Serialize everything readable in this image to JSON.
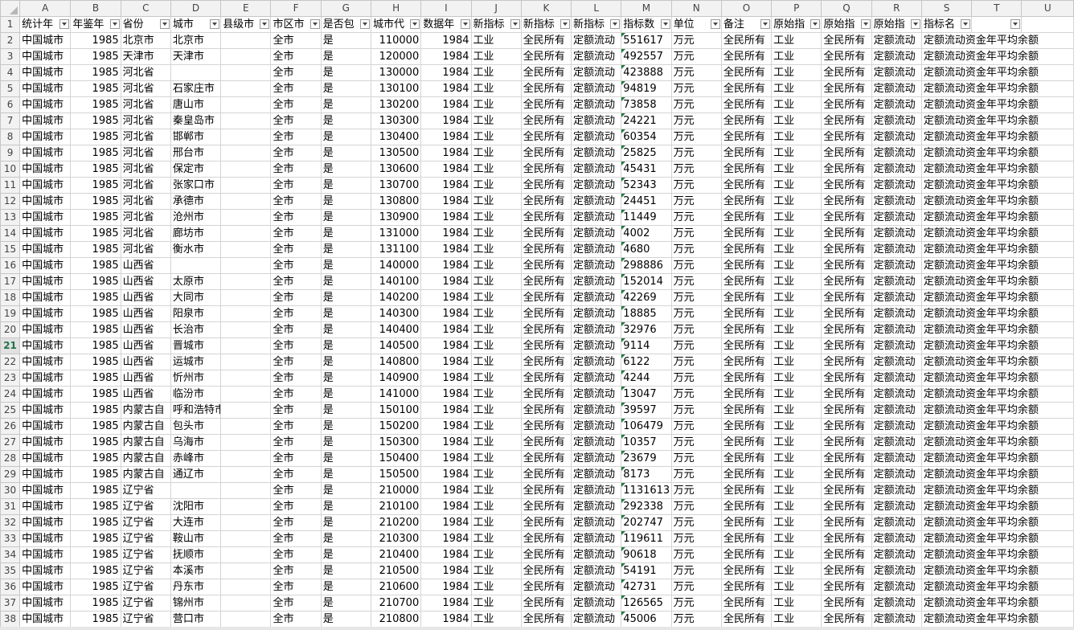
{
  "columns": [
    "A",
    "B",
    "C",
    "D",
    "E",
    "F",
    "G",
    "H",
    "I",
    "J",
    "K",
    "L",
    "M",
    "N",
    "O",
    "P",
    "Q",
    "R",
    "S",
    "T",
    "U"
  ],
  "headers": [
    "统计年",
    "年鉴年",
    "省份",
    "城市",
    "县级市",
    "市区市",
    "是否包",
    "城市代",
    "数据年",
    "新指标",
    "新指标",
    "新指标",
    "指标数",
    "单位",
    "备注",
    "原始指",
    "原始指",
    "原始指",
    "指标名",
    "",
    ""
  ],
  "filter_icon": "filter-dropdown-icon",
  "selected_row": 21,
  "rows": [
    {
      "n": 2,
      "city": "北京市",
      "province": "北京市",
      "code": "110000",
      "value": "551617"
    },
    {
      "n": 3,
      "city": "天津市",
      "province": "天津市",
      "code": "120000",
      "value": "492557"
    },
    {
      "n": 4,
      "city": "",
      "province": "河北省",
      "code": "130000",
      "value": "423888"
    },
    {
      "n": 5,
      "city": "石家庄市",
      "province": "河北省",
      "code": "130100",
      "value": "94819"
    },
    {
      "n": 6,
      "city": "唐山市",
      "province": "河北省",
      "code": "130200",
      "value": "73858"
    },
    {
      "n": 7,
      "city": "秦皇岛市",
      "province": "河北省",
      "code": "130300",
      "value": "24221"
    },
    {
      "n": 8,
      "city": "邯郸市",
      "province": "河北省",
      "code": "130400",
      "value": "60354"
    },
    {
      "n": 9,
      "city": "邢台市",
      "province": "河北省",
      "code": "130500",
      "value": "25825"
    },
    {
      "n": 10,
      "city": "保定市",
      "province": "河北省",
      "code": "130600",
      "value": "45431"
    },
    {
      "n": 11,
      "city": "张家口市",
      "province": "河北省",
      "code": "130700",
      "value": "52343"
    },
    {
      "n": 12,
      "city": "承德市",
      "province": "河北省",
      "code": "130800",
      "value": "24451"
    },
    {
      "n": 13,
      "city": "沧州市",
      "province": "河北省",
      "code": "130900",
      "value": "11449"
    },
    {
      "n": 14,
      "city": "廊坊市",
      "province": "河北省",
      "code": "131000",
      "value": "4002"
    },
    {
      "n": 15,
      "city": "衡水市",
      "province": "河北省",
      "code": "131100",
      "value": "4680"
    },
    {
      "n": 16,
      "city": "",
      "province": "山西省",
      "code": "140000",
      "value": "298886"
    },
    {
      "n": 17,
      "city": "太原市",
      "province": "山西省",
      "code": "140100",
      "value": "152014"
    },
    {
      "n": 18,
      "city": "大同市",
      "province": "山西省",
      "code": "140200",
      "value": "42269"
    },
    {
      "n": 19,
      "city": "阳泉市",
      "province": "山西省",
      "code": "140300",
      "value": "18885"
    },
    {
      "n": 20,
      "city": "长治市",
      "province": "山西省",
      "code": "140400",
      "value": "32976"
    },
    {
      "n": 21,
      "city": "晋城市",
      "province": "山西省",
      "code": "140500",
      "value": "9114"
    },
    {
      "n": 22,
      "city": "运城市",
      "province": "山西省",
      "code": "140800",
      "value": "6122"
    },
    {
      "n": 23,
      "city": "忻州市",
      "province": "山西省",
      "code": "140900",
      "value": "4244"
    },
    {
      "n": 24,
      "city": "临汾市",
      "province": "山西省",
      "code": "141000",
      "value": "13047"
    },
    {
      "n": 25,
      "city": "呼和浩特市",
      "province": "内蒙古自",
      "code": "150100",
      "value": "39597"
    },
    {
      "n": 26,
      "city": "包头市",
      "province": "内蒙古自",
      "code": "150200",
      "value": "106479"
    },
    {
      "n": 27,
      "city": "乌海市",
      "province": "内蒙古自",
      "code": "150300",
      "value": "10357"
    },
    {
      "n": 28,
      "city": "赤峰市",
      "province": "内蒙古自",
      "code": "150400",
      "value": "23679"
    },
    {
      "n": 29,
      "city": "通辽市",
      "province": "内蒙古自",
      "code": "150500",
      "value": "8173"
    },
    {
      "n": 30,
      "city": "",
      "province": "辽宁省",
      "code": "210000",
      "value": "1131613"
    },
    {
      "n": 31,
      "city": "沈阳市",
      "province": "辽宁省",
      "code": "210100",
      "value": "292338"
    },
    {
      "n": 32,
      "city": "大连市",
      "province": "辽宁省",
      "code": "210200",
      "value": "202747"
    },
    {
      "n": 33,
      "city": "鞍山市",
      "province": "辽宁省",
      "code": "210300",
      "value": "119611"
    },
    {
      "n": 34,
      "city": "抚顺市",
      "province": "辽宁省",
      "code": "210400",
      "value": "90618"
    },
    {
      "n": 35,
      "city": "本溪市",
      "province": "辽宁省",
      "code": "210500",
      "value": "54191"
    },
    {
      "n": 36,
      "city": "丹东市",
      "province": "辽宁省",
      "code": "210600",
      "value": "42731"
    },
    {
      "n": 37,
      "city": "锦州市",
      "province": "辽宁省",
      "code": "210700",
      "value": "126565"
    },
    {
      "n": 38,
      "city": "营口市",
      "province": "辽宁省",
      "code": "210800",
      "value": "45006"
    }
  ],
  "constants": {
    "stat_year_label": "中国城市",
    "yearbook_year": "1985",
    "district": "全市",
    "included": "是",
    "data_year": "1984",
    "new_indicator_1": "工业",
    "new_indicator_2": "全民所有",
    "new_indicator_3": "定额流动",
    "unit": "万元",
    "remark": "全民所有",
    "orig_indicator_1": "工业",
    "orig_indicator_2": "全民所有",
    "orig_indicator_3": "定额流动",
    "indicator_name": "定额流动资金年平均余额"
  }
}
